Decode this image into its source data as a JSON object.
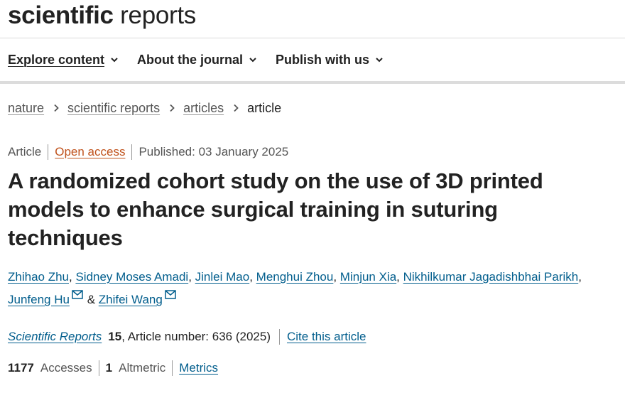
{
  "header": {
    "brand_bold": "scientific",
    "brand_light": "reports"
  },
  "nav": {
    "items": [
      {
        "label": "Explore content",
        "icon": "chevron-down-icon"
      },
      {
        "label": "About the journal",
        "icon": "chevron-down-icon"
      },
      {
        "label": "Publish with us",
        "icon": "chevron-down-icon"
      }
    ]
  },
  "breadcrumb": {
    "items": [
      "nature",
      "scientific reports",
      "articles"
    ],
    "current": "article"
  },
  "article_meta": {
    "type": "Article",
    "access": "Open access",
    "published": "Published: 03 January 2025"
  },
  "article": {
    "title": "A randomized cohort study on the use of 3D printed models to enhance surgical training in suturing techniques",
    "authors": [
      "Zhihao Zhu",
      "Sidney Moses Amadi",
      "Jinlei Mao",
      "Menghui Zhou",
      "Minjun Xia",
      "Nikhilkumar Jagadishbhai Parikh",
      "Junfeng Hu",
      "Zhifei Wang"
    ],
    "author_separator": ", ",
    "author_and": "&"
  },
  "citation": {
    "journal": "Scientific Reports",
    "volume": "15",
    "article_number_text": ", Article number: 636 (2025)",
    "cite_link": "Cite this article"
  },
  "metrics": {
    "accesses_count": "1177",
    "accesses_label": "Accesses",
    "altmetric_count": "1",
    "altmetric_label": "Altmetric",
    "metrics_link": "Metrics"
  },
  "colors": {
    "link": "#025e8d",
    "open_access": "#c0521c",
    "text": "#222222",
    "muted": "#555555"
  }
}
